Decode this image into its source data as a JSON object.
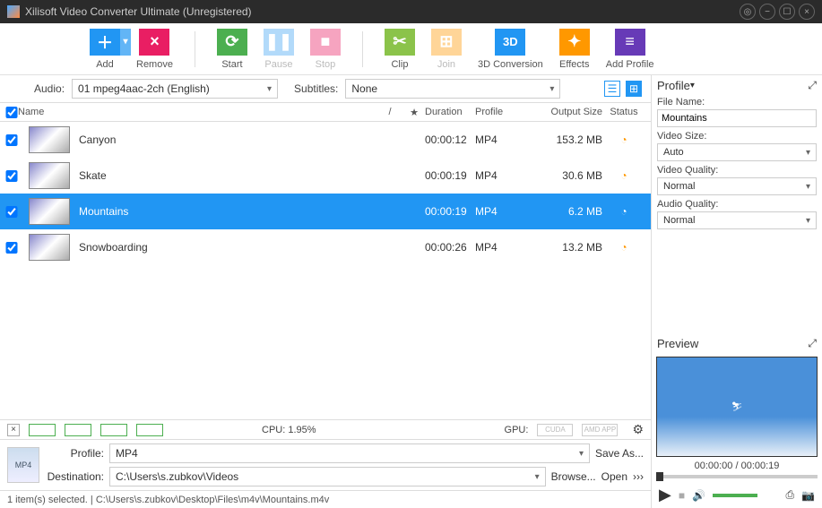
{
  "title": "Xilisoft Video Converter Ultimate (Unregistered)",
  "toolbar": {
    "add": "Add",
    "remove": "Remove",
    "start": "Start",
    "pause": "Pause",
    "stop": "Stop",
    "clip": "Clip",
    "join": "Join",
    "d3": "3D Conversion",
    "effects": "Effects",
    "addprofile": "Add Profile"
  },
  "audio_label": "Audio:",
  "audio_value": "01 mpeg4aac-2ch (English)",
  "subtitles_label": "Subtitles:",
  "subtitles_value": "None",
  "columns": {
    "name": "Name",
    "duration": "Duration",
    "profile": "Profile",
    "output": "Output Size",
    "status": "Status"
  },
  "files": [
    {
      "name": "Canyon",
      "duration": "00:00:12",
      "profile": "MP4",
      "output": "153.2 MB",
      "selected": false
    },
    {
      "name": "Skate",
      "duration": "00:00:19",
      "profile": "MP4",
      "output": "30.6 MB",
      "selected": false
    },
    {
      "name": "Mountains",
      "duration": "00:00:19",
      "profile": "MP4",
      "output": "6.2 MB",
      "selected": true
    },
    {
      "name": "Snowboarding",
      "duration": "00:00:26",
      "profile": "MP4",
      "output": "13.2 MB",
      "selected": false
    }
  ],
  "cpu_label": "CPU: 1.95%",
  "gpu_label": "GPU:",
  "gpu_cuda": "CUDA",
  "gpu_amd": "AMD APP",
  "profile_label": "Profile:",
  "profile_value": "MP4",
  "dest_label": "Destination:",
  "dest_value": "C:\\Users\\s.zubkov\\Videos",
  "saveas": "Save As...",
  "browse": "Browse...",
  "open": "Open",
  "statusbar": "1 item(s) selected. | C:\\Users\\s.zubkov\\Desktop\\Files\\m4v\\Mountains.m4v",
  "panel": {
    "title": "Profile",
    "filename_label": "File Name:",
    "filename_value": "Mountains",
    "videosize_label": "Video Size:",
    "videosize_value": "Auto",
    "videoq_label": "Video Quality:",
    "videoq_value": "Normal",
    "audioq_label": "Audio Quality:",
    "audioq_value": "Normal"
  },
  "preview": {
    "title": "Preview",
    "time": "00:00:00 / 00:00:19"
  }
}
